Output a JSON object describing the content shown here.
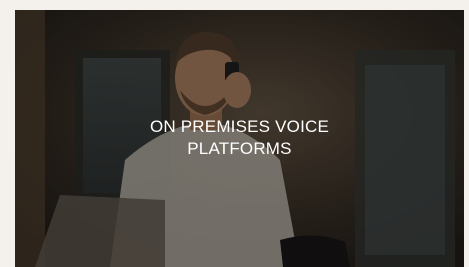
{
  "card": {
    "title_line1": "ON PREMISES VOICE",
    "title_line2": "PLATFORMS",
    "image_subject": "man-on-phone-photo"
  },
  "colors": {
    "page_background": "#f4f1ec",
    "overlay": "rgba(0,0,0,0.38)",
    "title_text": "#ffffff"
  }
}
